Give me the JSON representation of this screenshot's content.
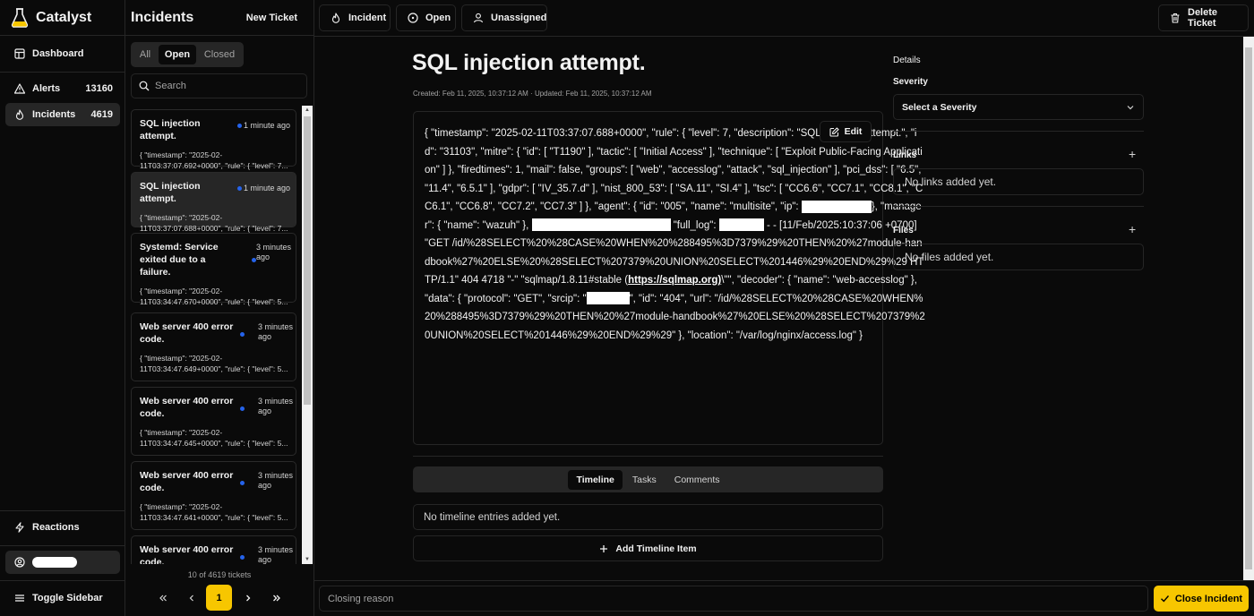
{
  "app": {
    "name": "Catalyst"
  },
  "nav": {
    "items": [
      {
        "label": "Dashboard"
      },
      {
        "label": "Alerts",
        "count": "13160"
      },
      {
        "label": "Incidents",
        "count": "4619"
      }
    ],
    "reactions": "Reactions",
    "toggle": "Toggle Sidebar"
  },
  "list": {
    "title": "Incidents",
    "new_ticket": "New Ticket",
    "filters": [
      "All",
      "Open",
      "Closed"
    ],
    "search_placeholder": "Search",
    "tickets": [
      {
        "title": "SQL injection attempt.",
        "time": "1 minute ago",
        "body": "{ \"timestamp\": \"2025-02-11T03:37:07.692+0000\", \"rule\": { \"level\": 7..."
      },
      {
        "title": "SQL injection attempt.",
        "time": "1 minute ago",
        "body": "{ \"timestamp\": \"2025-02-11T03:37:07.688+0000\", \"rule\": { \"level\": 7..."
      },
      {
        "title": "Systemd: Service exited due to a failure.",
        "time": "3 minutes ago",
        "body": "{ \"timestamp\": \"2025-02-11T03:34:47.670+0000\", \"rule\": { \"level\": 5..."
      },
      {
        "title": "Web server 400 error code.",
        "time": "3 minutes ago",
        "body": "{ \"timestamp\": \"2025-02-11T03:34:47.649+0000\", \"rule\": { \"level\": 5..."
      },
      {
        "title": "Web server 400 error code.",
        "time": "3 minutes ago",
        "body": "{ \"timestamp\": \"2025-02-11T03:34:47.645+0000\", \"rule\": { \"level\": 5..."
      },
      {
        "title": "Web server 400 error code.",
        "time": "3 minutes ago",
        "body": "{ \"timestamp\": \"2025-02-11T03:34:47.641+0000\", \"rule\": { \"level\": 5..."
      },
      {
        "title": "Web server 400 error code.",
        "time": "3 minutes ago",
        "body": ""
      }
    ],
    "pagination": {
      "info": "10 of 4619 tickets",
      "current": "1"
    }
  },
  "toolbar": {
    "type": "Incident",
    "status": "Open",
    "owner": "Unassigned",
    "delete": "Delete Ticket"
  },
  "ticket": {
    "title": "SQL injection attempt.",
    "meta": "Created: Feb 11, 2025, 10:37:12 AM · Updated: Feb 11, 2025, 10:37:12 AM",
    "edit": "Edit",
    "desc_parts": [
      "{ \"timestamp\": \"2025-02-11T03:37:07.688+0000\", \"rule\": { \"level\": 7, \"description\": \"SQL injection attempt.\", \"id\": \"31103\", \"mitre\": { \"id\": [ \"T1190\" ], \"tactic\": [ \"Initial Access\" ], \"technique\": [ \"Exploit Public-Facing Application\" ] }, \"firedtimes\": 1, \"mail\": false, \"groups\": [ \"web\", \"accesslog\", \"attack\", \"sql_injection\" ], \"pci_dss\": [ \"6.5\", \"11.4\", \"6.5.1\" ], \"gdpr\": [ \"IV_35.7.d\" ], \"nist_800_53\": [ \"SA.11\", \"SI.4\" ], \"tsc\": [ \"CC6.6\", \"CC7.1\", \"CC8.1\", \"CC6.1\", \"CC6.8\", \"CC7.2\", \"CC7.3\" ] }, \"agent\": { \"id\": \"005\", \"name\": \"multisite\", \"ip\":",
      "}, \"manager\": { \"name\": \"wazuh\" },",
      "\"full_log\":",
      "- - [11/Feb/2025:10:37:06 +0700] \"GET /id/%28SELECT%20%28CASE%20WHEN%20%288495%3D7379%29%20THEN%20%27module-handbook%27%20ELSE%20%28SELECT%207379%20UNION%20SELECT%201446%29%20END%29%29 HTTP/1.1\" 404 4718 \"-\" \"sqlmap/1.8.11#stable (",
      "https://sqlmap.org)",
      "\\\"\", \"decoder\": { \"name\": \"web-accesslog\" }, \"data\": { \"protocol\": \"GET\", \"srcip\": \"",
      "\", \"id\": \"404\", \"url\": \"/id/%28SELECT%20%28CASE%20WHEN%20%288495%3D7379%29%20THEN%20%27module-handbook%27%20ELSE%20%28SELECT%207379%20UNION%20SELECT%201446%29%20END%29%29\" }, \"location\": \"/var/log/nginx/access.log\" }"
    ],
    "tabs": [
      "Timeline",
      "Tasks",
      "Comments"
    ],
    "no_timeline": "No timeline entries added yet.",
    "add_timeline": "Add Timeline Item"
  },
  "details": {
    "heading": "Details",
    "severity_label": "Severity",
    "severity_placeholder": "Select a Severity",
    "links_label": "Links",
    "links_empty": "No links added yet.",
    "files_label": "Files",
    "files_empty": "No files added yet."
  },
  "footer": {
    "closing_placeholder": "Closing reason",
    "close_button": "Close Incident"
  },
  "colors": {
    "accent": "#f7c600",
    "unread_dot": "#2563eb",
    "background": "#0a0a0a",
    "border": "#262626"
  }
}
